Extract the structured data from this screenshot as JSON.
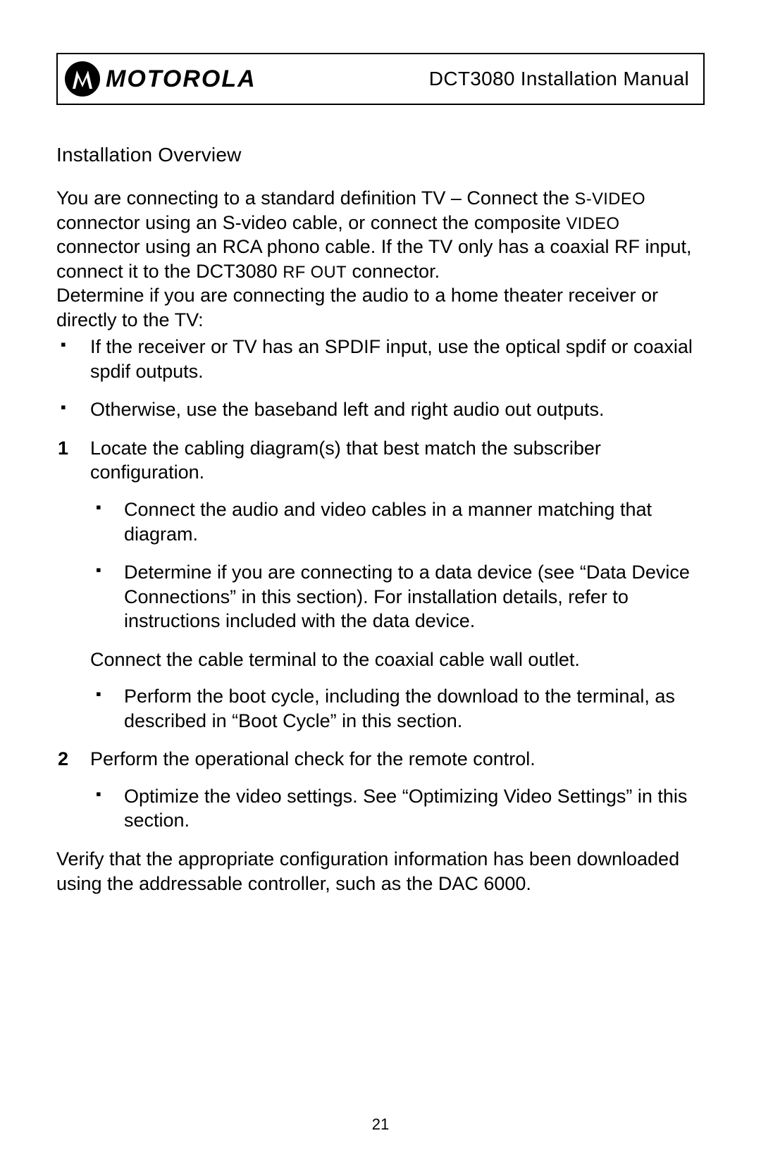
{
  "header": {
    "brand": "MOTOROLA",
    "doc_title": "DCT3080 Installation Manual"
  },
  "section": {
    "heading": "Installation Overview"
  },
  "content": {
    "intro_part1": "You are connecting to a standard definition TV – Connect the ",
    "intro_sc1": "S-VIDEO",
    "intro_part2": " connector using an S-video cable, or connect the composite ",
    "intro_sc2": "VIDEO",
    "intro_part3": " connector using an RCA phono cable. If the TV only has a coaxial RF input, connect it to the DCT3080 ",
    "intro_sc3": "RF OUT",
    "intro_part4": " connector.",
    "audio_intro": "Determine if you are connecting the audio to a home theater receiver or directly to the TV:",
    "bullets_top": [
      "If the receiver or TV has an SPDIF input, use the optical spdif or coaxial spdif outputs.",
      "Otherwise, use the baseband left and right audio out outputs."
    ],
    "numbered": [
      {
        "num": "1",
        "text": "Locate the cabling diagram(s) that best match the subscriber configuration.",
        "sub1": [
          "Connect the audio and video cables in a manner matching that diagram.",
          "Determine if you are connecting to a data device (see “Data Device Connections” in this section). For installation details, refer to instructions included with the data device."
        ],
        "after_para": "Connect the cable terminal to the coaxial cable wall outlet.",
        "sub2": [
          "Perform the boot cycle, including the download to the terminal, as described in “Boot Cycle” in this section."
        ]
      },
      {
        "num": "2",
        "text": "Perform the operational check for the remote control.",
        "sub1": [
          "Optimize the video settings. See “Optimizing Video Settings” in this section."
        ]
      }
    ],
    "final": "Verify that the appropriate configuration information has been downloaded using the addressable controller, such as the DAC 6000."
  },
  "page_number": "21"
}
